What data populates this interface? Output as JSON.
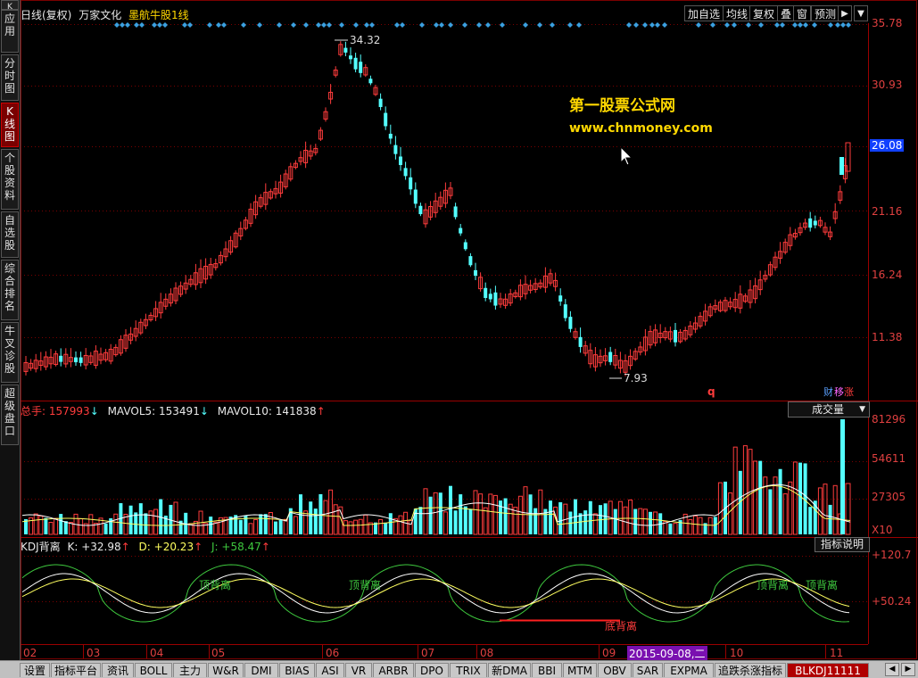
{
  "header": {
    "chart_type": "日线(复权)",
    "stock_name": "万家文化",
    "formula_name": "墨航牛股1线",
    "buttons": [
      "加自选",
      "均线",
      "复权",
      "叠",
      "窗",
      "预测"
    ],
    "arrow_icon": "play-arrow-icon",
    "menu_icon": "menu-down-icon"
  },
  "left_tabs": [
    {
      "label": "应用",
      "active": false
    },
    {
      "label": "分时图",
      "active": false
    },
    {
      "label": "K线图",
      "active": true
    },
    {
      "label": "个股资料",
      "active": false
    },
    {
      "label": "自选股",
      "active": false
    },
    {
      "label": "综合排名",
      "active": false
    },
    {
      "label": "牛叉诊股",
      "active": false
    },
    {
      "label": "超级盘口",
      "active": false
    }
  ],
  "left_handle": "K",
  "watermark": {
    "line1": "第一股票公式网",
    "line2": "www.chnmoney.com"
  },
  "price_axis": [
    "35.78",
    "30.93",
    "26.08",
    "21.16",
    "16.24",
    "11.38"
  ],
  "price_highlight": "26.08",
  "price_annotations": {
    "high": "34.32",
    "low": "7.93"
  },
  "badges": {
    "q": "q",
    "cai": "财",
    "yi": "移",
    "zhang": "涨"
  },
  "volume_panel": {
    "total_label": "总手:",
    "total_value": "157993",
    "mavol5_label": "MAVOL5:",
    "mavol5_value": "153491",
    "mavol10_label": "MAVOL10:",
    "mavol10_value": "141838",
    "dropdown": "成交量",
    "axis": [
      "81296",
      "54611",
      "27305"
    ],
    "unit": "X10"
  },
  "kdj_panel": {
    "name": "KDJ背离",
    "k_label": "K:",
    "k_value": "+32.98",
    "d_label": "D:",
    "d_value": "+20.23",
    "j_label": "J:",
    "j_value": "+58.47",
    "help_button": "指标说明",
    "axis": [
      "+120.7",
      "+50.24"
    ],
    "annotations": [
      "顶背离",
      "顶背离",
      "底背离",
      "顶背离",
      "顶背离"
    ]
  },
  "time_axis": {
    "labels": [
      "02",
      "03",
      "04",
      "05",
      "06",
      "07",
      "08",
      "09",
      "10",
      "11"
    ],
    "cursor_date": "2015-09-08,二"
  },
  "bottom_tabs": [
    {
      "label": "设置",
      "active": false
    },
    {
      "label": "指标平台",
      "active": false
    },
    {
      "label": "资讯",
      "active": false
    },
    {
      "label": "BOLL",
      "active": false
    },
    {
      "label": "主力",
      "active": false
    },
    {
      "label": "W&R",
      "active": false
    },
    {
      "label": "DMI",
      "active": false
    },
    {
      "label": "BIAS",
      "active": false
    },
    {
      "label": "ASI",
      "active": false
    },
    {
      "label": "VR",
      "active": false
    },
    {
      "label": "ARBR",
      "active": false
    },
    {
      "label": "DPO",
      "active": false
    },
    {
      "label": "TRIX",
      "active": false
    },
    {
      "label": "新DMA",
      "active": false
    },
    {
      "label": "BBI",
      "active": false
    },
    {
      "label": "MTM",
      "active": false
    },
    {
      "label": "OBV",
      "active": false
    },
    {
      "label": "SAR",
      "active": false
    },
    {
      "label": "EXPMA",
      "active": false
    },
    {
      "label": "追跌杀涨指标",
      "active": false
    },
    {
      "label": "BLKDJ11111",
      "active": true
    }
  ],
  "colors": {
    "up": "#ff3c3c",
    "down": "#54ffff",
    "grid": "#7a0000",
    "axis_text": "#e04040",
    "watermark": "#ffd800"
  }
}
